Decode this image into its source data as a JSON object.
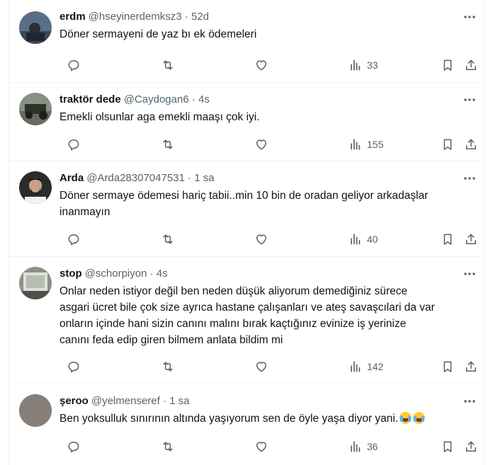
{
  "tweets": [
    {
      "name": "erdm",
      "handle": "@hseyinerdemksz3",
      "sep": "·",
      "time": "52d",
      "text": "Döner sermayeni de yaz bı ek ödemeleri",
      "views": "33"
    },
    {
      "name": "traktör dede",
      "handle": "@Caydogan6",
      "sep": "·",
      "time": "4s",
      "text": "Emekli olsunlar aga emekli maaşı çok iyi.",
      "views": "155"
    },
    {
      "name": "Arda",
      "handle": "@Arda28307047531",
      "sep": "·",
      "time": "1 sa",
      "text": "Döner sermaye ödemesi hariç tabii..min 10 bin de oradan geliyor arkadaşlar\ninanmayın",
      "views": "40"
    },
    {
      "name": "stop",
      "handle": "@schorpiyon",
      "sep": "·",
      "time": "4s",
      "text": "Onlar neden istiyor değil ben neden düşük aliyorum demediğiniz sürece\nasgari ücret bile çok size ayrıca hastane çalışanları ve ateş savaşcılari da var\nonların içinde hani sizin canını malını bırak kaçtığınız evinize iş yerinize\ncanını feda edip giren bilmem anlata bildim mi",
      "views": "142"
    },
    {
      "name": "şeroo",
      "handle": "@yelmenseref",
      "sep": "·",
      "time": "1 sa",
      "text": "Ben yoksulluk sınırının altında yaşıyorum sen de öyle yaşa diyor yani.",
      "views": "36",
      "emoji": "face-with-tears-of-joy x2"
    }
  ],
  "icons": {
    "reply": "reply-icon",
    "retweet": "retweet-icon",
    "like": "like-icon",
    "views": "views-icon",
    "bookmark": "bookmark-icon",
    "share": "share-icon",
    "more": "more-icon"
  },
  "colors": {
    "text": "#0f1419",
    "secondary": "#536471",
    "border": "#eff3f4"
  }
}
